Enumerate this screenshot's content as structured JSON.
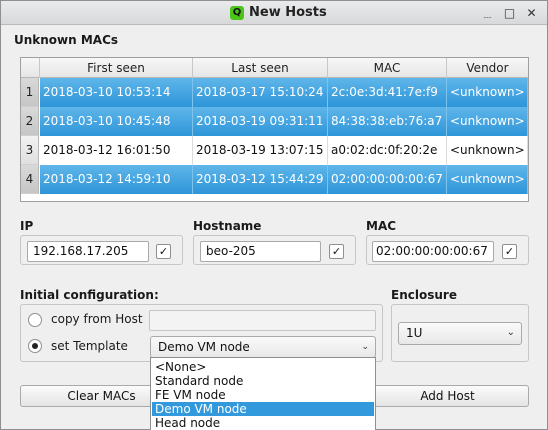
{
  "window": {
    "title": "New Hosts",
    "app_icon_letter": "Q",
    "buttons": {
      "minimize": "﹍",
      "maximize": "□",
      "close": "✕"
    }
  },
  "unknown_macs": {
    "label": "Unknown MACs",
    "columns": [
      "First seen",
      "Last seen",
      "MAC",
      "Vendor"
    ],
    "rows": [
      {
        "num": "1",
        "first_seen": "2018-03-10 10:53:14",
        "last_seen": "2018-03-17 15:10:24",
        "mac": "2c:0e:3d:41:7e:f9",
        "vendor": "<unknown>",
        "selected": true
      },
      {
        "num": "2",
        "first_seen": "2018-03-10 10:45:48",
        "last_seen": "2018-03-19 09:31:11",
        "mac": "84:38:38:eb:76:a7",
        "vendor": "<unknown>",
        "selected": true
      },
      {
        "num": "3",
        "first_seen": "2018-03-12 16:01:50",
        "last_seen": "2018-03-19 13:07:15",
        "mac": "a0:02:dc:0f:20:2e",
        "vendor": "<unknown>",
        "selected": false
      },
      {
        "num": "4",
        "first_seen": "2018-03-12 14:59:10",
        "last_seen": "2018-03-12 15:44:29",
        "mac": "02:00:00:00:00:67",
        "vendor": "<unknown>",
        "selected": true
      }
    ]
  },
  "ip": {
    "label": "IP",
    "value": "192.168.17.205",
    "checked": "✓"
  },
  "hostname": {
    "label": "Hostname",
    "value": "beo-205",
    "checked": "✓"
  },
  "mac": {
    "label": "MAC",
    "value": "02:00:00:00:00:67",
    "checked": "✓"
  },
  "initial_config": {
    "label": "Initial configuration:",
    "copy_from_host_label": "copy from Host",
    "copy_from_host_value": "",
    "set_template_label": "set Template",
    "template_selected": "Demo VM node",
    "template_options": [
      "<None>",
      "Standard node",
      "FE VM node",
      "Demo VM node",
      "Head node"
    ],
    "highlighted_option": "Demo VM node"
  },
  "enclosure": {
    "label": "Enclosure",
    "selected": "1U"
  },
  "actions": {
    "clear_macs": "Clear MACs",
    "add_host": "Add Host"
  },
  "colors": {
    "selection": "#2e95d8",
    "highlight": "#3399dd",
    "app_icon": "#4cc51b"
  }
}
